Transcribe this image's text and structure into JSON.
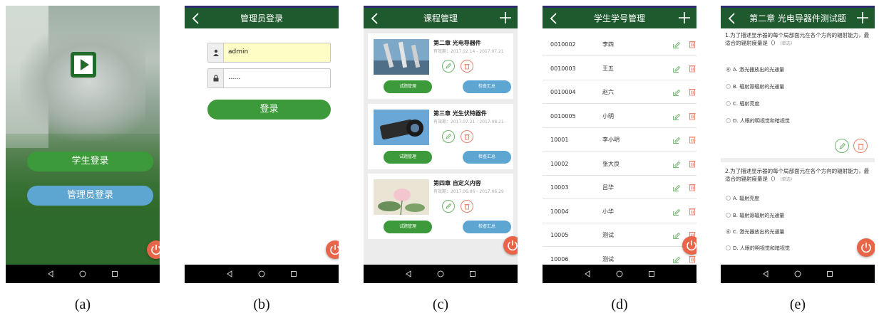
{
  "screens": {
    "a": {
      "student_login": "学生登录",
      "admin_login": "管理员登录",
      "caption": "(a)"
    },
    "b": {
      "title": "管理员登录",
      "username": "admin",
      "password": "......",
      "login": "登录",
      "caption": "(b)"
    },
    "c": {
      "title": "课程管理",
      "courses": [
        {
          "title": "第二章 光电导器件",
          "date": "有效期：2017.02.14 - 2017.07.21"
        },
        {
          "title": "第三章 光生伏特器件",
          "date": "有效期：2017.07.21 - 2017.08.21"
        },
        {
          "title": "第四章 自定义内容",
          "date": "有效期：2017.06.06 - 2017.06.29"
        }
      ],
      "btn_manage": "试题管理",
      "btn_summary": "检查汇总",
      "caption": "(c)"
    },
    "d": {
      "title": "学生学号管理",
      "students": [
        {
          "id": "0010002",
          "name": "李四"
        },
        {
          "id": "0010003",
          "name": "王五"
        },
        {
          "id": "0010004",
          "name": "赵六"
        },
        {
          "id": "0010005",
          "name": "小明"
        },
        {
          "id": "10001",
          "name": "李小明"
        },
        {
          "id": "10002",
          "name": "张大良"
        },
        {
          "id": "10003",
          "name": "吕华"
        },
        {
          "id": "10004",
          "name": "小华"
        },
        {
          "id": "10005",
          "name": "测试"
        },
        {
          "id": "10006",
          "name": "测试"
        }
      ],
      "caption": "(d)"
    },
    "e": {
      "title": "第二章 光电导器件测试题",
      "questions": [
        {
          "text": "1.为了描述显示器的每个局部面元在各个方向的辐射能力，最适合的辐射度量是（）",
          "tag": "(单选)",
          "options": [
            "A. 激光器放出的光通量",
            "B. 辐射源辐射的光通量",
            "C. 辐射亮度",
            "D. 人眼的明视觉和暗视觉"
          ],
          "selected": 0
        },
        {
          "text": "2.为了描述显示器的每个局部面元在各个方向的辐射能力，最适合的辐射度量是（）",
          "tag": "(单选)",
          "options": [
            "A. 辐射亮度",
            "B. 辐射源辐射的光通量",
            "C. 激光器放出的光通量",
            "D. 人眼的明视觉和暗视觉"
          ],
          "selected": 2
        }
      ],
      "caption": "(e)"
    }
  },
  "colors": {
    "header": "#1f5a2e",
    "green": "#3c9a3a",
    "blue": "#5ca6d1",
    "power": "#e8654a"
  },
  "icons": [
    "back-icon",
    "plus-icon",
    "power-icon",
    "user-icon",
    "lock-icon",
    "edit-icon",
    "trash-icon",
    "nav-back-icon",
    "nav-home-icon",
    "nav-recents-icon",
    "play-logo-icon"
  ]
}
